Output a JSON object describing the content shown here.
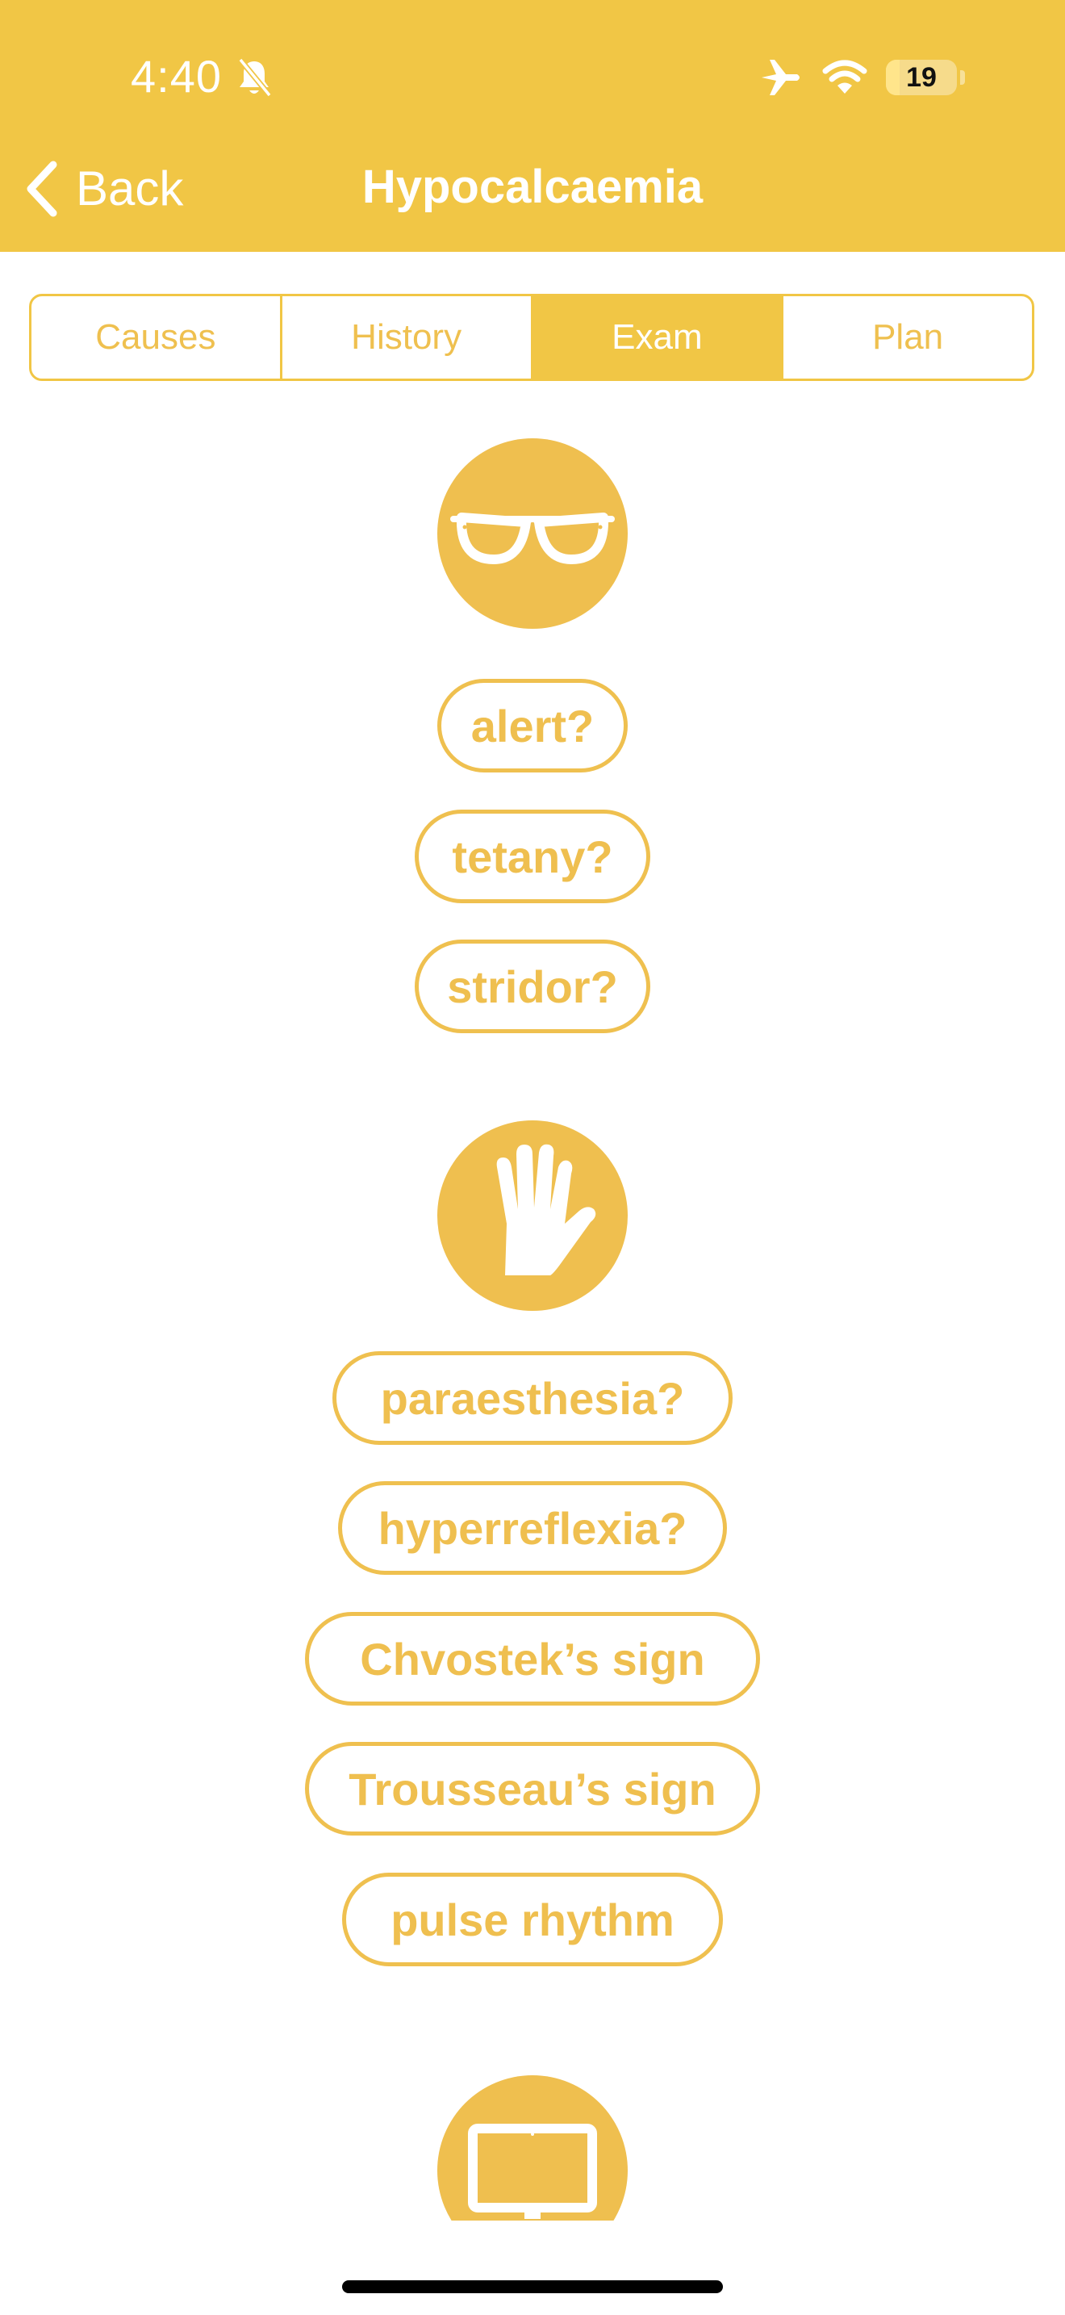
{
  "status_bar": {
    "time": "4:40",
    "battery_level": "19"
  },
  "nav": {
    "back_label": "Back",
    "title": "Hypocalcaemia"
  },
  "tabs": [
    {
      "label": "Causes",
      "active": false
    },
    {
      "label": "History",
      "active": false
    },
    {
      "label": "Exam",
      "active": true
    },
    {
      "label": "Plan",
      "active": false
    }
  ],
  "sections": [
    {
      "icon": "glasses-icon",
      "items": [
        "alert?",
        "tetany?",
        "stridor?"
      ]
    },
    {
      "icon": "hand-icon",
      "items": [
        "paraesthesia?",
        "hyperreflexia?",
        "Chvostek’s sign",
        "Trousseau’s sign",
        "pulse rhythm"
      ]
    },
    {
      "icon": "monitor-icon",
      "items": []
    }
  ],
  "colors": {
    "header": "#F1C645",
    "accent": "#EFBF4F",
    "text_on_accent": "#FFFFFF"
  }
}
